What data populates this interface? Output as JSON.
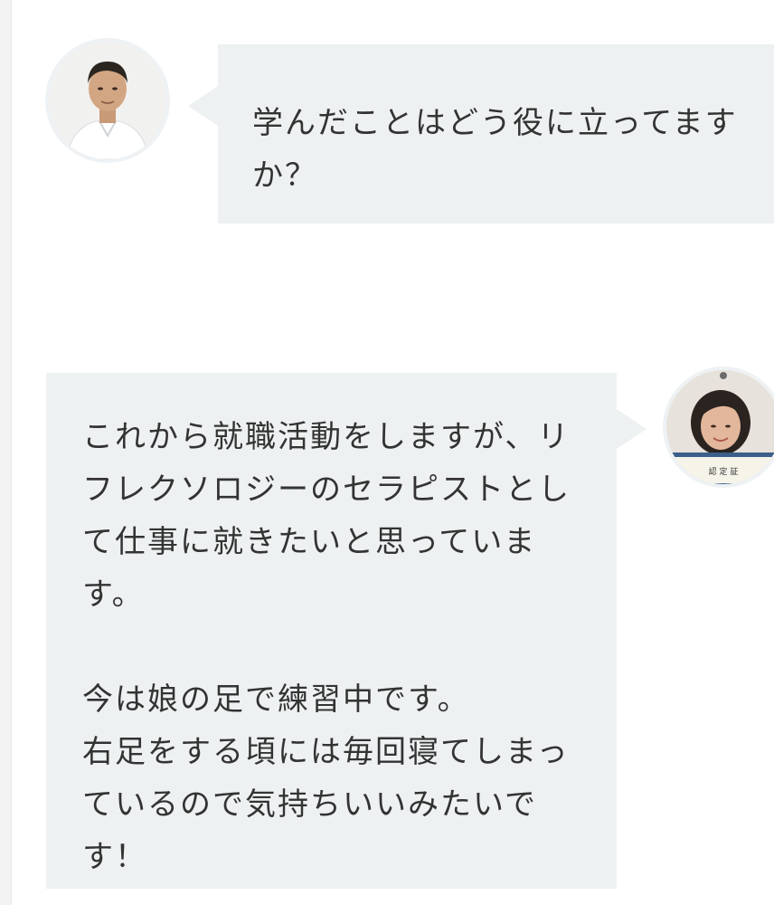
{
  "conversation": {
    "question": {
      "speaker": "interviewer",
      "lines": [
        "学んだことはどう役に立ってます",
        "か？"
      ]
    },
    "answer": {
      "speaker": "student",
      "paragraphs": [
        {
          "lines": [
            "これから就職活動をしますが、リ",
            "フレクソロジーのセラピストとし",
            "て仕事に就きたいと思っていま",
            "す。"
          ]
        },
        {
          "lines": [
            "今は娘の足で練習中です。",
            "右足をする頃には毎回寝てしまっ",
            "ているので気持ちいいみたいで",
            "す！"
          ]
        }
      ]
    },
    "certificate_text": "認 定 証"
  },
  "colors": {
    "bubble_background": "#eef1f2",
    "text": "#333333",
    "page_background": "#ffffff"
  }
}
